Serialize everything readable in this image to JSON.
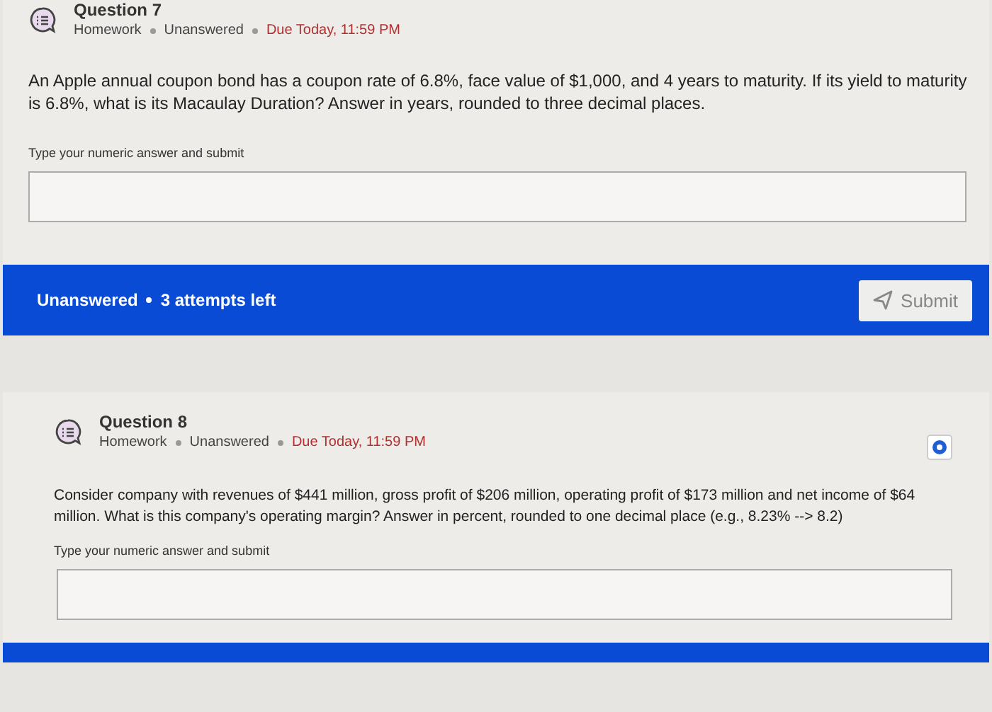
{
  "questions": [
    {
      "title": "Question 7",
      "meta": [
        "Homework",
        "Unanswered"
      ],
      "due": "Due Today, 11:59 PM",
      "flagged": false,
      "prompt": "An Apple annual coupon bond has a coupon rate of 6.8%, face value of $1,000, and 4 years to maturity. If its yield to maturity is 6.8%, what is its Macaulay Duration? Answer in years, rounded to three decimal places.",
      "answer_label": "Type your numeric answer and submit",
      "footer": {
        "status": "Unanswered",
        "attempts": "3 attempts left",
        "button": "Submit"
      }
    },
    {
      "title": "Question 8",
      "meta": [
        "Homework",
        "Unanswered"
      ],
      "due": "Due Today, 11:59 PM",
      "flagged": true,
      "prompt": "Consider company with revenues of $441 million, gross profit of $206 million, operating profit of $173 million and net income of $64 million. What is this company's operating margin? Answer in percent, rounded to one decimal place (e.g., 8.23% --> 8.2)",
      "answer_label": "Type your numeric answer and submit"
    }
  ]
}
